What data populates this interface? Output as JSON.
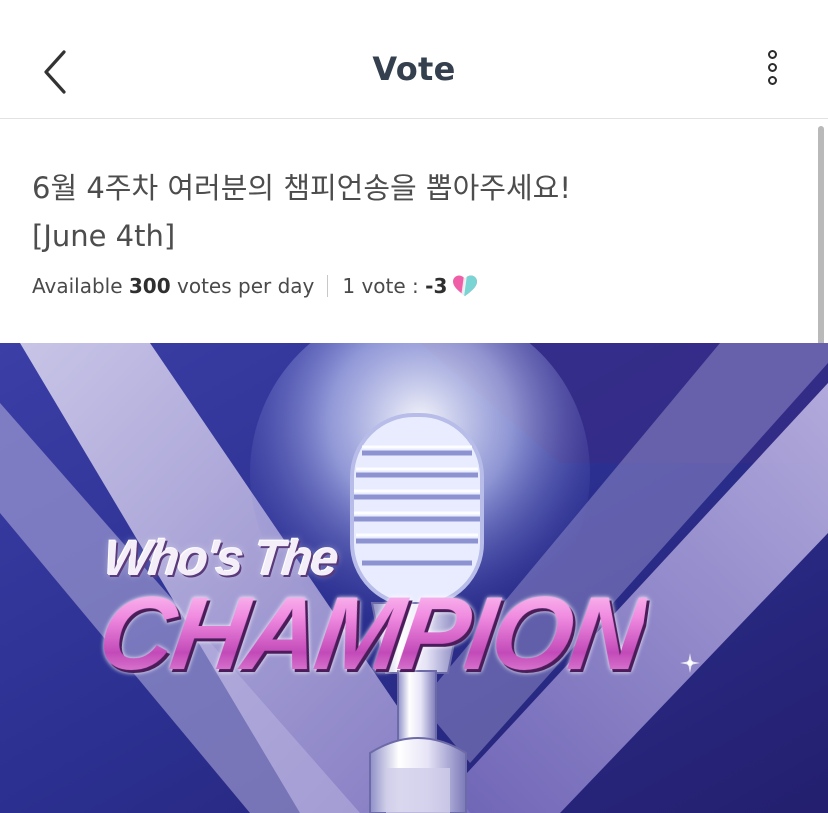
{
  "header": {
    "title": "Vote",
    "back_icon": "chevron-left-icon",
    "more_icon": "more-vertical-icon"
  },
  "vote": {
    "title_line1": "6월 4주차 여러분의 챔피언송을 뽑아주세요!",
    "title_line2": "[June 4th]",
    "available_prefix": "Available",
    "available_count": "300",
    "available_suffix": "votes per day",
    "cost_prefix": "1 vote :",
    "cost_value": "-3",
    "cost_icon": "heart-icon"
  },
  "banner": {
    "line1": "Who's The",
    "line2": "CHAMPION",
    "icon": "microphone-icon"
  },
  "colors": {
    "title_text": "#35404f",
    "banner_bg": "#2a2f8c",
    "champion_pink": "#e48ad6",
    "heart_pink": "#ee5fa8",
    "heart_teal": "#7ad4d4"
  }
}
